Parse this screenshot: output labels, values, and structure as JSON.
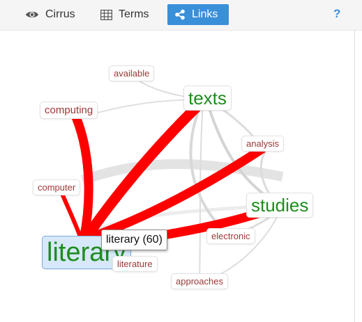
{
  "toolbar": {
    "tabs": [
      {
        "label": "Cirrus",
        "icon": "eye-icon",
        "active": false
      },
      {
        "label": "Terms",
        "icon": "table-icon",
        "active": false
      },
      {
        "label": "Links",
        "icon": "share-icon",
        "active": true
      }
    ],
    "help_label": "?"
  },
  "graph": {
    "nodes": [
      {
        "term": "available",
        "type": "context"
      },
      {
        "term": "texts",
        "type": "keyword"
      },
      {
        "term": "computing",
        "type": "context"
      },
      {
        "term": "analysis",
        "type": "context"
      },
      {
        "term": "computer",
        "type": "context"
      },
      {
        "term": "studies",
        "type": "keyword"
      },
      {
        "term": "electronic",
        "type": "context"
      },
      {
        "term": "literary",
        "type": "keyword",
        "selected": true
      },
      {
        "term": "literature",
        "type": "context"
      },
      {
        "term": "approaches",
        "type": "context"
      }
    ],
    "tooltip": "literary (60)"
  },
  "colors": {
    "accent": "#3a8fd9",
    "link_strong": "#ff0000",
    "link_weak": "#d4d4d4",
    "keyword": "#1f8c1f",
    "context": "#9c3737",
    "selected_bg": "#d6e8fa"
  }
}
